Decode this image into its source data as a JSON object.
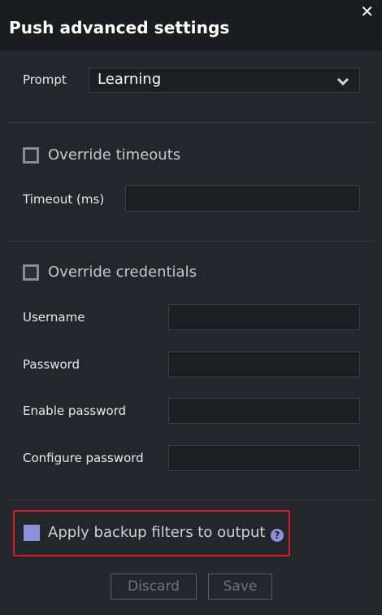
{
  "dialog": {
    "title": "Push advanced settings",
    "close_glyph": "✕"
  },
  "prompt": {
    "label": "Prompt",
    "selected": "Learning"
  },
  "timeouts": {
    "override_label": "Override timeouts",
    "timeout_label": "Timeout (ms)",
    "timeout_value": ""
  },
  "credentials": {
    "override_label": "Override credentials",
    "username_label": "Username",
    "username_value": "",
    "password_label": "Password",
    "password_value": "",
    "enable_password_label": "Enable password",
    "enable_password_value": "",
    "configure_password_label": "Configure password",
    "configure_password_value": ""
  },
  "backup": {
    "apply_filters_label": "Apply backup filters to output",
    "help_glyph": "?"
  },
  "buttons": {
    "discard": "Discard",
    "save": "Save"
  },
  "colors": {
    "accent": "#8b92dd",
    "highlight_border": "#e01a1a",
    "background": "#23272b",
    "titlebar": "#1a1c1e"
  }
}
